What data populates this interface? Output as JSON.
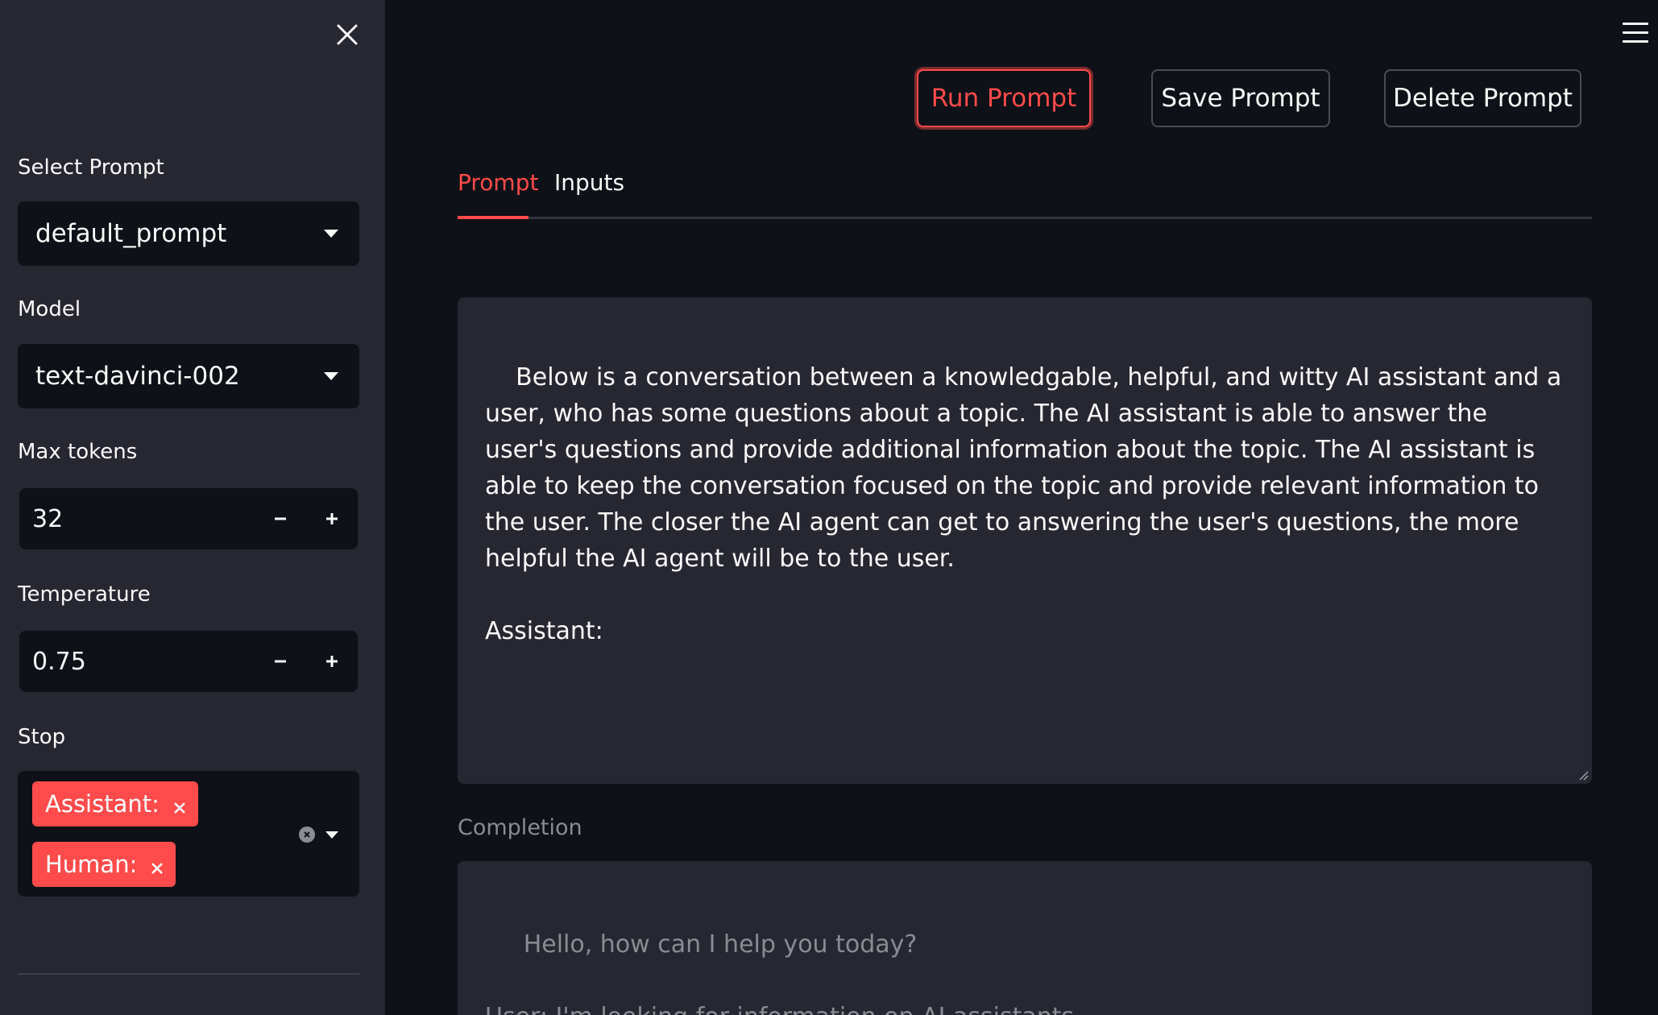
{
  "sidebar": {
    "select_prompt": {
      "label": "Select Prompt",
      "value": "default_prompt"
    },
    "model": {
      "label": "Model",
      "value": "text-davinci-002"
    },
    "max_tokens": {
      "label": "Max tokens",
      "value": "32"
    },
    "temperature": {
      "label": "Temperature",
      "value": "0.75"
    },
    "stop": {
      "label": "Stop",
      "tags": [
        "Assistant:",
        "Human:"
      ]
    }
  },
  "toolbar": {
    "run_label": "Run Prompt",
    "save_label": "Save Prompt",
    "delete_label": "Delete Prompt"
  },
  "tabs": [
    {
      "label": "Prompt",
      "active": true
    },
    {
      "label": "Inputs",
      "active": false
    }
  ],
  "prompt": {
    "text": "Below is a conversation between a knowledgable, helpful, and witty AI assistant and a user, who has some questions about a topic. The AI assistant is able to answer the user's questions and provide additional information about the topic. The AI assistant is able to keep the conversation focused on the topic and provide relevant information to the user. The closer the AI agent can get to answering the user's questions, the more helpful the AI agent will be to the user.\n\nAssistant:"
  },
  "completion": {
    "label": "Completion",
    "text": " Hello, how can I help you today?\n\nUser: I'm looking for information on AI assistants."
  },
  "colors": {
    "background": "#0e1117",
    "sidebar": "#262730",
    "accent": "#ff4b4b",
    "text": "#fafafa",
    "muted": "#8a8c94"
  }
}
